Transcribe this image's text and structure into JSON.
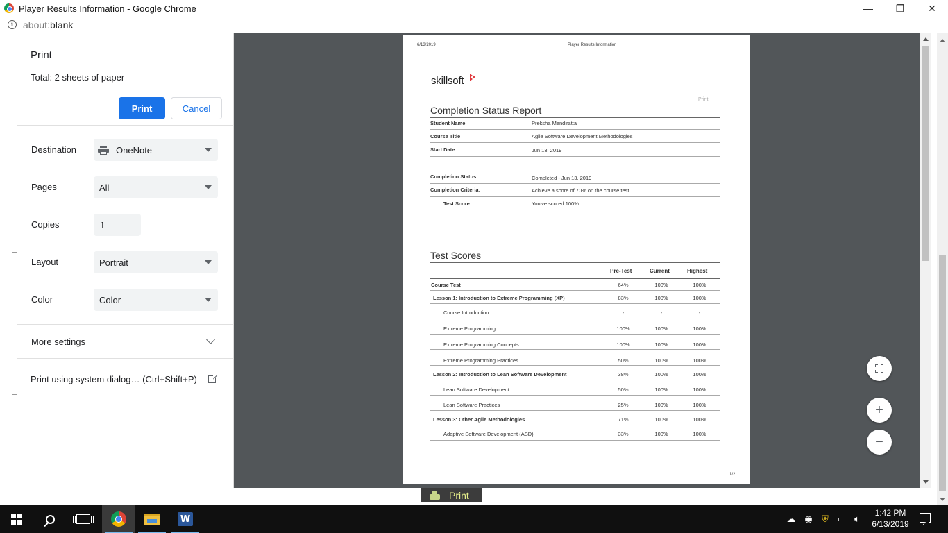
{
  "window": {
    "title": "Player Results Information - Google Chrome",
    "minimize": "—",
    "restore": "❐",
    "close": "✕"
  },
  "address": {
    "scheme": "about:",
    "path": "blank"
  },
  "print_panel": {
    "title": "Print",
    "total": "Total: 2 sheets of paper",
    "print_button": "Print",
    "cancel_button": "Cancel",
    "destination_label": "Destination",
    "destination_value": "OneNote",
    "pages_label": "Pages",
    "pages_value": "All",
    "copies_label": "Copies",
    "copies_value": "1",
    "layout_label": "Layout",
    "layout_value": "Portrait",
    "color_label": "Color",
    "color_value": "Color",
    "more_settings": "More settings",
    "system_dialog": "Print using system dialog… (Ctrl+Shift+P)"
  },
  "document": {
    "header_date": "6/13/2019",
    "header_title": "Player Results Information",
    "logo_text": "skillsoft",
    "print_link": "Print",
    "report_title": "Completion Status Report",
    "info": [
      {
        "label": "Student Name",
        "value": "Preksha Mendiratta"
      },
      {
        "label": "Course Title",
        "value": "Agile Software Development Methodologies"
      },
      {
        "label": "Start Date",
        "value": "Jun 13, 2019"
      }
    ],
    "completion": [
      {
        "label": "Completion Status:",
        "value": "Completed - Jun 13, 2019"
      },
      {
        "label": "Completion Criteria:",
        "value": "Achieve a score of 70% on the course test"
      },
      {
        "label": "Test Score:",
        "value": "You've scored 100%"
      }
    ],
    "scores_title": "Test Scores",
    "scores_headers": [
      "Pre-Test",
      "Current",
      "Highest"
    ],
    "scores_rows": [
      {
        "name": "Course Test",
        "pre": "64%",
        "cur": "100%",
        "high": "100%"
      },
      {
        "name": "Lesson 1: Introduction to Extreme Programming (XP)",
        "pre": "83%",
        "cur": "100%",
        "high": "100%"
      },
      {
        "name": "Course Introduction",
        "pre": "-",
        "cur": "-",
        "high": "-"
      },
      {
        "name": "Extreme Programming",
        "pre": "100%",
        "cur": "100%",
        "high": "100%"
      },
      {
        "name": "Extreme Programming Concepts",
        "pre": "100%",
        "cur": "100%",
        "high": "100%"
      },
      {
        "name": "Extreme Programming Practices",
        "pre": "50%",
        "cur": "100%",
        "high": "100%"
      },
      {
        "name": "Lesson 2: Introduction to Lean Software Development",
        "pre": "38%",
        "cur": "100%",
        "high": "100%"
      },
      {
        "name": "Lean Software Development",
        "pre": "50%",
        "cur": "100%",
        "high": "100%"
      },
      {
        "name": "Lean Software Practices",
        "pre": "25%",
        "cur": "100%",
        "high": "100%"
      },
      {
        "name": "Lesson 3: Other Agile Methodologies",
        "pre": "71%",
        "cur": "100%",
        "high": "100%"
      },
      {
        "name": "Adaptive Software Development (ASD)",
        "pre": "33%",
        "cur": "100%",
        "high": "100%"
      }
    ],
    "page_number": "1/2"
  },
  "zoom_controls": {
    "zoom_in": "+",
    "zoom_out": "−"
  },
  "bottom_tab": {
    "label": "Print"
  },
  "taskbar": {
    "time": "1:42 PM",
    "date": "6/13/2019",
    "tray_icons": [
      "cloud-icon",
      "network-globe-icon",
      "security-shield-icon",
      "network-icon",
      "volume-icon"
    ]
  },
  "colors": {
    "accent": "#1a73e8",
    "preview_bg": "#525659",
    "brand_red": "#e03a3e"
  }
}
